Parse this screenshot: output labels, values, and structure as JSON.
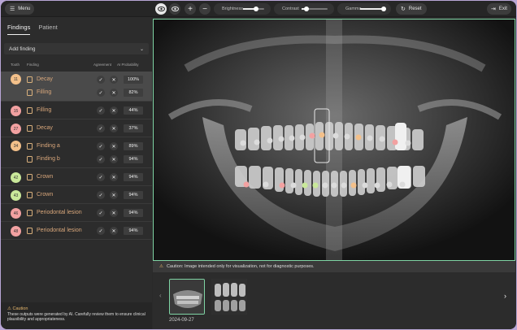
{
  "toolbar": {
    "menu_label": "Menu",
    "brightness_label": "Brightness",
    "contrast_label": "Contrast",
    "gamma_label": "Gamma",
    "reset_label": "Reset",
    "exit_label": "Exit",
    "brightness_value": 0.6,
    "contrast_value": 0.2,
    "gamma_value": 0.95
  },
  "sidebar": {
    "tabs": [
      {
        "label": "Findings",
        "active": true
      },
      {
        "label": "Patient",
        "active": false
      }
    ],
    "add_finding_label": "Add finding",
    "columns": {
      "tooth": "Tooth",
      "finding": "Finding",
      "agreement": "Agreement",
      "probability": "AI Probability"
    },
    "groups": [
      {
        "tooth": "11",
        "color": "#f3c08a",
        "selected": true,
        "findings": [
          {
            "label": "Decay",
            "prob": "100%"
          },
          {
            "label": "Filling",
            "prob": "82%"
          }
        ]
      },
      {
        "tooth": "15",
        "color": "#f2a1a1",
        "findings": [
          {
            "label": "Filling",
            "prob": "44%"
          }
        ]
      },
      {
        "tooth": "27",
        "color": "#f2a1a1",
        "findings": [
          {
            "label": "Decay",
            "prob": "37%"
          }
        ]
      },
      {
        "tooth": "34",
        "color": "#f3c08a",
        "findings": [
          {
            "label": "Finding a",
            "prob": "89%"
          },
          {
            "label": "Finding b",
            "prob": "94%"
          }
        ]
      },
      {
        "tooth": "42",
        "color": "#c9e89a",
        "findings": [
          {
            "label": "Crown",
            "prob": "94%"
          }
        ]
      },
      {
        "tooth": "43",
        "color": "#c9e89a",
        "findings": [
          {
            "label": "Crown",
            "prob": "94%"
          }
        ]
      },
      {
        "tooth": "46",
        "color": "#f2a1a1",
        "findings": [
          {
            "label": "Periodontal lesion",
            "prob": "94%"
          }
        ]
      },
      {
        "tooth": "48",
        "color": "#f2a1a1",
        "findings": [
          {
            "label": "Periodontal lesion",
            "prob": "94%"
          }
        ]
      }
    ],
    "caution_title": "Caution",
    "caution_text": "These outputs were generated by AI. Carefully review them to ensure clinical plausibility and appropriateness."
  },
  "viewer": {
    "caution_text": "Caution: Image intended only for visualization, not for diagnostic purposes.",
    "thumbnail_date": "2024-09-27"
  },
  "colors": {
    "accent": "#7fd4a4",
    "finding_text": "#d9a77b",
    "warn": "#e8b86d"
  }
}
